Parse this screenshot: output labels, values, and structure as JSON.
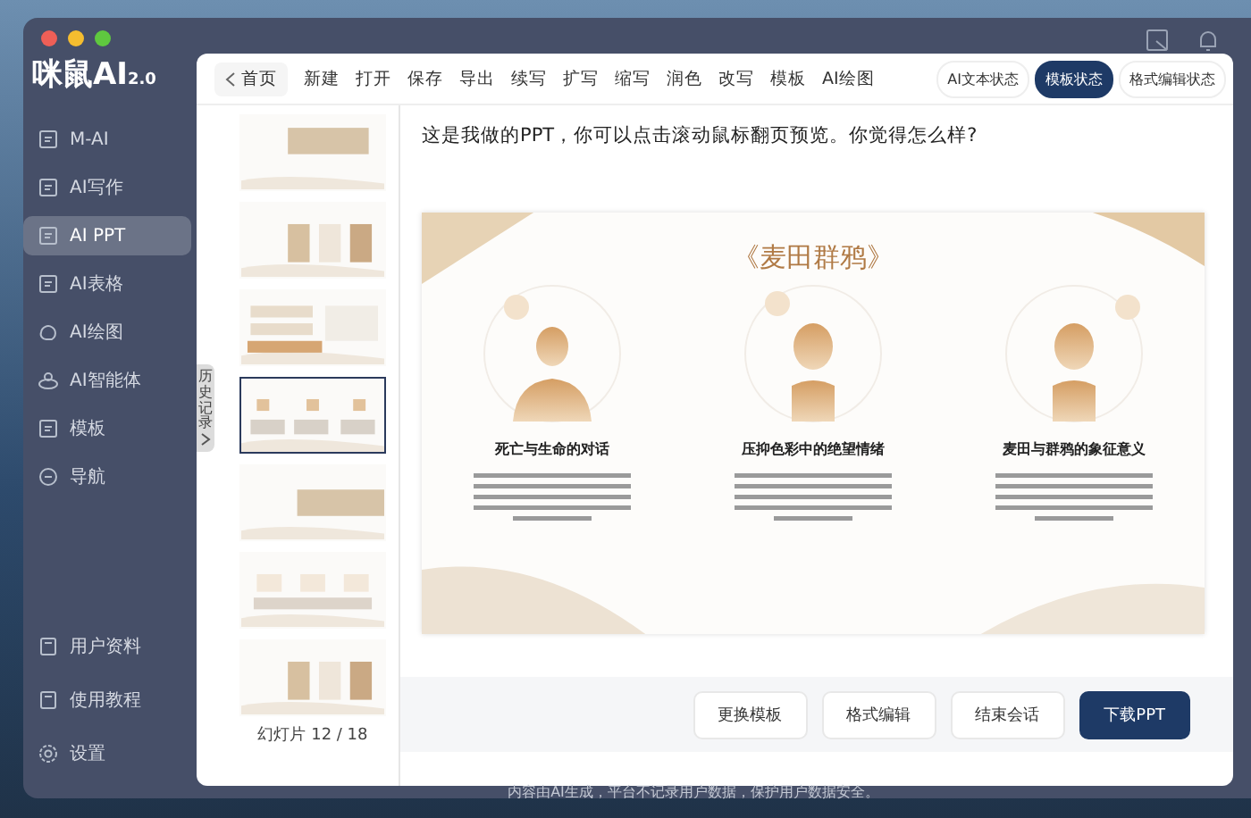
{
  "app": {
    "logo": "咪鼠AI",
    "version": "2.0"
  },
  "sidebar": {
    "items": [
      {
        "label": "M-AI",
        "selected": false
      },
      {
        "label": "AI写作",
        "selected": false
      },
      {
        "label": "AI PPT",
        "selected": true
      },
      {
        "label": "AI表格",
        "selected": false
      },
      {
        "label": "AI绘图",
        "selected": false
      },
      {
        "label": "AI智能体",
        "selected": false
      },
      {
        "label": "模板",
        "selected": false
      },
      {
        "label": "导航",
        "selected": false
      }
    ],
    "bottom_items": [
      {
        "label": "用户资料"
      },
      {
        "label": "使用教程"
      },
      {
        "label": "设置"
      }
    ]
  },
  "toolbar": {
    "back": "首页",
    "items": [
      "新建",
      "打开",
      "保存",
      "导出",
      "续写",
      "扩写",
      "缩写",
      "润色",
      "改写",
      "模板",
      "AI绘图"
    ],
    "modes": [
      {
        "label": "AI文本状态",
        "selected": false
      },
      {
        "label": "模板状态",
        "selected": true
      },
      {
        "label": "格式编辑状态",
        "selected": false
      }
    ]
  },
  "history_tab": "历史记录",
  "thumbnails": [
    {
      "selected": false
    },
    {
      "selected": false
    },
    {
      "selected": false
    },
    {
      "selected": true
    },
    {
      "selected": false
    },
    {
      "selected": false
    },
    {
      "selected": false
    }
  ],
  "slide_counter": "幻灯片 12 / 18",
  "message": "这是我做的PPT，你可以点击滚动鼠标翻页预览。你觉得怎么样?",
  "slide": {
    "title": "《麦田群鸦》",
    "columns": [
      {
        "heading": "死亡与生命的对话"
      },
      {
        "heading": "压抑色彩中的绝望情绪"
      },
      {
        "heading": "麦田与群鸦的象征意义"
      }
    ]
  },
  "actions": [
    {
      "label": "更换模板",
      "primary": false
    },
    {
      "label": "格式编辑",
      "primary": false
    },
    {
      "label": "结束会话",
      "primary": false
    },
    {
      "label": "下载PPT",
      "primary": true
    }
  ],
  "footer": "内容由AI生成，平台不记录用户数据，保护用户数据安全。"
}
